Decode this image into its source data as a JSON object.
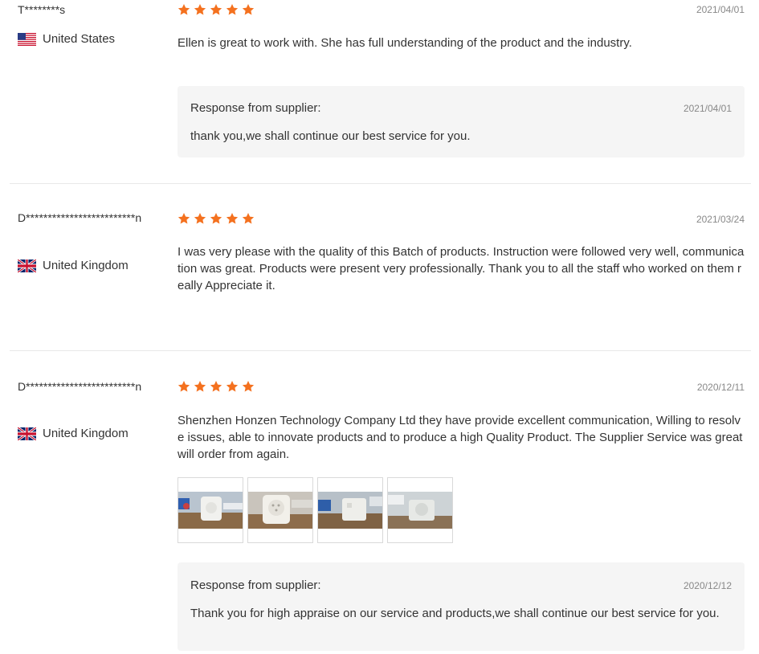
{
  "reviews": [
    {
      "user": "T********s",
      "country": "United States",
      "flag_icon": "us-flag-icon",
      "rating": 5,
      "date": "2021/04/01",
      "text": "Ellen is great to work with. She has full understanding of the product and the industry.",
      "response": {
        "title": "Response from supplier:",
        "date": "2021/04/01",
        "text": "thank you,we shall continue our best service for you."
      }
    },
    {
      "user": "D*************************n",
      "country": "United Kingdom",
      "flag_icon": "uk-flag-icon",
      "rating": 5,
      "date": "2021/03/24",
      "text": "I was very please with the quality of this Batch of products. Instruction were followed very well, communication was great. Products were present very professionally. Thank you to all the staff who worked on them really Appreciate it."
    },
    {
      "user": "D*************************n",
      "country": "United Kingdom",
      "flag_icon": "uk-flag-icon",
      "rating": 5,
      "date": "2020/12/11",
      "text": "Shenzhen Honzen Technology Company Ltd they have provide excellent communication, Willing to resolve issues, able to innovate products and to produce a high Quality Product. The Supplier Service was great will order from again.",
      "photo_count": 4,
      "response": {
        "title": "Response from supplier:",
        "date": "2020/12/12",
        "text": "Thank you for high appraise on our service and products,we shall continue our best service for you."
      }
    }
  ],
  "colors": {
    "star": "#f4711f",
    "response_bg": "#f5f5f5",
    "divider": "#e8e8e8"
  }
}
